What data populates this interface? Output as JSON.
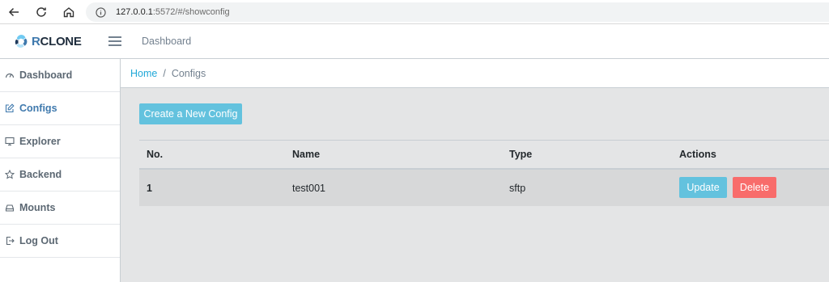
{
  "browser": {
    "url_host": "127.0.0.1",
    "url_rest": ":5572/#/showconfig",
    "icons": [
      "back-icon",
      "reload-icon",
      "home-icon",
      "info-icon"
    ]
  },
  "header": {
    "brand_r": "R",
    "brand_rest": "CLONE",
    "dashboard_link": "Dashboard"
  },
  "sidebar": {
    "items": [
      {
        "label": "Dashboard",
        "icon": "speedometer-icon",
        "active": false
      },
      {
        "label": "Configs",
        "icon": "edit-icon",
        "active": true
      },
      {
        "label": "Explorer",
        "icon": "monitor-icon",
        "active": false
      },
      {
        "label": "Backend",
        "icon": "star-icon",
        "active": false
      },
      {
        "label": "Mounts",
        "icon": "drive-icon",
        "active": false
      },
      {
        "label": "Log Out",
        "icon": "logout-icon",
        "active": false
      }
    ]
  },
  "breadcrumb": {
    "home": "Home",
    "separator": "/",
    "current": "Configs"
  },
  "main": {
    "create_button": "Create a New Config",
    "table": {
      "headers": [
        "No.",
        "Name",
        "Type",
        "Actions"
      ],
      "rows": [
        {
          "no": "1",
          "name": "test001",
          "type": "sftp",
          "update": "Update",
          "delete": "Delete"
        }
      ]
    }
  },
  "colors": {
    "accent": "#20a8d8",
    "info_button": "#63c2de",
    "danger_button": "#f86c6b",
    "active_nav": "#3f79ad",
    "main_bg": "#e4e5e6"
  }
}
